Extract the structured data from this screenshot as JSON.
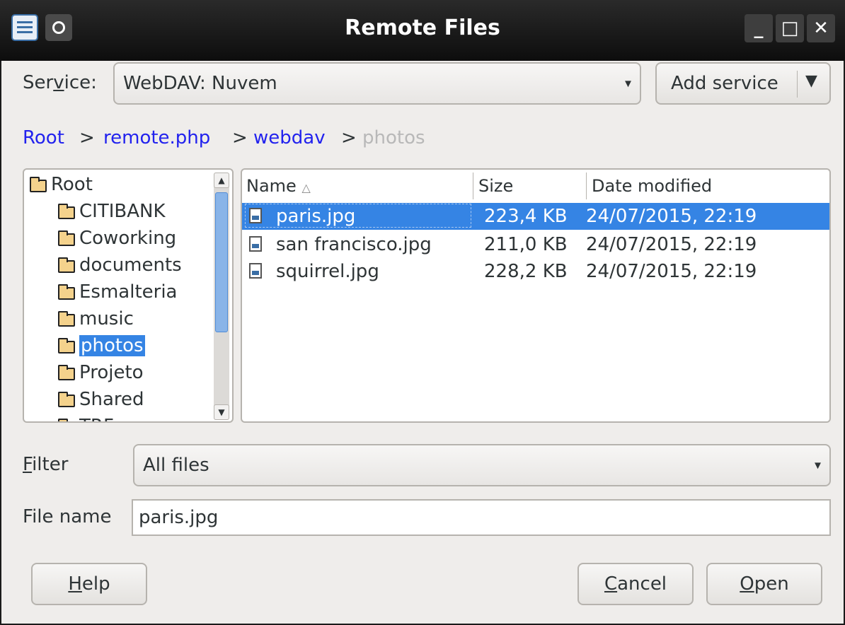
{
  "window": {
    "title": "Remote Files",
    "controls": [
      "minimize",
      "maximize",
      "close"
    ]
  },
  "service": {
    "label_pre": "Ser",
    "label_u": "v",
    "label_post": "ice:",
    "value": "WebDAV: Nuvem",
    "add_button": "Add service"
  },
  "breadcrumb": {
    "items": [
      "Root",
      "remote.php",
      "webdav"
    ],
    "current": "photos",
    "separator": ">"
  },
  "tree": {
    "root": "Root",
    "items": [
      "CITIBANK",
      "Coworking",
      "documents",
      "Esmalteria",
      "music",
      "photos",
      "Projeto",
      "Shared",
      "TRF"
    ],
    "selected": "photos"
  },
  "files": {
    "columns": [
      "Name",
      "Size",
      "Date modified"
    ],
    "sort_indicator": "△",
    "rows": [
      {
        "name": "paris.jpg",
        "size": "223,4 KB",
        "date": "24/07/2015, 22:19",
        "selected": true
      },
      {
        "name": "san francisco.jpg",
        "size": "211,0 KB",
        "date": "24/07/2015, 22:19",
        "selected": false
      },
      {
        "name": "squirrel.jpg",
        "size": "228,2 KB",
        "date": "24/07/2015, 22:19",
        "selected": false
      }
    ]
  },
  "filter": {
    "label_u": "F",
    "label_post": "ilter",
    "value": "All files"
  },
  "filename": {
    "label": "File name",
    "value": "paris.jpg"
  },
  "buttons": {
    "help_u": "H",
    "help_post": "elp",
    "cancel_u": "C",
    "cancel_post": "ancel",
    "open_u": "O",
    "open_post": "pen"
  },
  "colors": {
    "selection": "#3584e4",
    "link": "#2222ee",
    "titlebar": "#1a1a1a"
  }
}
